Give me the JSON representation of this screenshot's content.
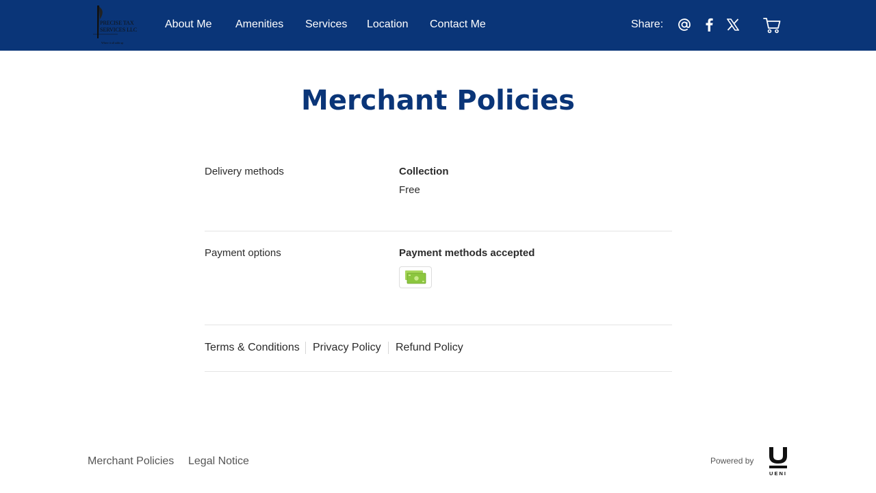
{
  "header": {
    "logo": {
      "line1": "PRECISE TAX",
      "line2": "SERVICES LLC",
      "tagline": "Where it all adds up"
    },
    "nav": [
      {
        "label": "About Me"
      },
      {
        "label": "Amenities"
      },
      {
        "label": "Services"
      },
      {
        "label": "Location"
      },
      {
        "label": "Contact Me"
      }
    ],
    "share_label": "Share:",
    "share_icons": [
      "at-sign-icon",
      "facebook-icon",
      "x-twitter-icon"
    ],
    "cart_icon": "shopping-cart-icon"
  },
  "main": {
    "title": "Merchant Policies",
    "delivery": {
      "label": "Delivery methods",
      "method": "Collection",
      "price": "Free"
    },
    "payment": {
      "label": "Payment options",
      "heading": "Payment methods accepted",
      "methods": [
        "cash-icon"
      ]
    },
    "policy_links": [
      "Terms & Conditions",
      "Privacy Policy",
      "Refund Policy"
    ]
  },
  "footer": {
    "links": [
      "Merchant Policies",
      "Legal Notice"
    ],
    "powered_by": "Powered by",
    "brand": "UENI"
  },
  "colors": {
    "header_bg": "#0a3578",
    "title": "#0a3578",
    "cash_green": "#8cc63f"
  }
}
